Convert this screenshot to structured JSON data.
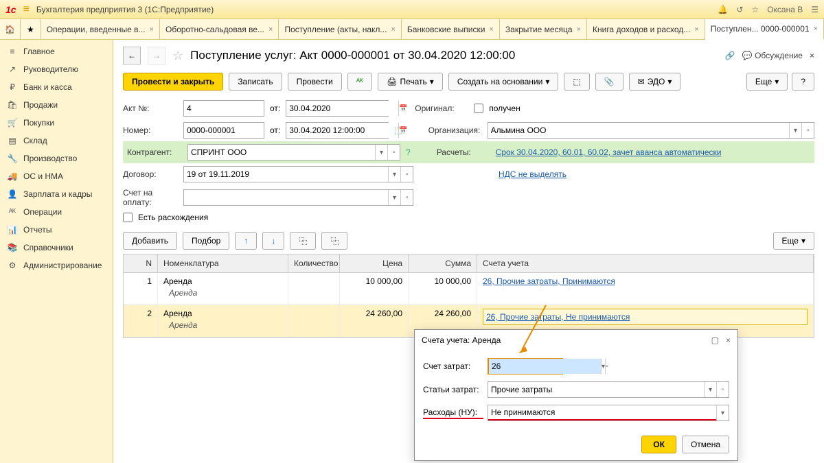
{
  "titlebar": {
    "app": "Бухгалтерия предприятия 3  (1С:Предприятие)",
    "user": "Оксана В"
  },
  "tabs": [
    {
      "label": "Операции, введенные в..."
    },
    {
      "label": "Оборотно-сальдовая ве..."
    },
    {
      "label": "Поступление (акты, накл..."
    },
    {
      "label": "Банковские выписки"
    },
    {
      "label": "Закрытие месяца"
    },
    {
      "label": "Книга доходов и расход..."
    },
    {
      "label": "Поступлен...  0000-000001",
      "active": true
    }
  ],
  "sidebar": [
    {
      "icon": "≡",
      "label": "Главное"
    },
    {
      "icon": "↗",
      "label": "Руководителю"
    },
    {
      "icon": "₽",
      "label": "Банк и касса"
    },
    {
      "icon": "🛍",
      "label": "Продажи"
    },
    {
      "icon": "🛒",
      "label": "Покупки"
    },
    {
      "icon": "▤",
      "label": "Склад"
    },
    {
      "icon": "🔧",
      "label": "Производство"
    },
    {
      "icon": "🚚",
      "label": "ОС и НМА"
    },
    {
      "icon": "👤",
      "label": "Зарплата и кадры"
    },
    {
      "icon": "ᴬᴷ",
      "label": "Операции"
    },
    {
      "icon": "📊",
      "label": "Отчеты"
    },
    {
      "icon": "📚",
      "label": "Справочники"
    },
    {
      "icon": "⚙",
      "label": "Администрирование"
    }
  ],
  "doc": {
    "title": "Поступление услуг: Акт 0000-000001 от 30.04.2020 12:00:00",
    "discuss": "Обсуждение",
    "buttons": {
      "post_close": "Провести и закрыть",
      "save": "Записать",
      "post": "Провести",
      "print": "Печать",
      "create_based": "Создать на основании",
      "edo": "ЭДО",
      "more": "Еще"
    },
    "fields": {
      "akt_label": "Акт №:",
      "akt": "4",
      "ot1": "от:",
      "date1": "30.04.2020",
      "nomer_label": "Номер:",
      "nomer": "0000-000001",
      "ot2": "от:",
      "date2": "30.04.2020 12:00:00",
      "kontragent_label": "Контрагент:",
      "kontragent": "СПРИНТ ООО",
      "dogovor_label": "Договор:",
      "dogovor": "19 от 19.11.2019",
      "schet_label": "Счет на оплату:",
      "original_label": "Оригинал:",
      "original_chk": "получен",
      "org_label": "Организация:",
      "org": "Альмина ООО",
      "raschety_label": "Расчеты:",
      "raschety_link": "Срок 30.04.2020, 60.01, 60.02, зачет аванса автоматически",
      "nds_link": "НДС не выделять",
      "rashozh": "Есть расхождения"
    },
    "tbl_btn": {
      "add": "Добавить",
      "select": "Подбор",
      "more": "Еще"
    },
    "columns": {
      "n": "N",
      "nom": "Номенклатура",
      "qty": "Количество",
      "price": "Цена",
      "sum": "Сумма",
      "acc": "Счета учета"
    },
    "rows": [
      {
        "n": "1",
        "nom": "Аренда",
        "nom2": "Аренда",
        "price": "10 000,00",
        "sum": "10 000,00",
        "acc": "26, Прочие затраты, Принимаются"
      },
      {
        "n": "2",
        "nom": "Аренда",
        "nom2": "Аренда",
        "price": "24 260,00",
        "sum": "24 260,00",
        "acc": "26, Прочие затраты, Не принимаются"
      }
    ]
  },
  "dialog": {
    "title": "Счета учета: Аренда",
    "schet_label": "Счет затрат:",
    "schet": "26",
    "statyi_label": "Статьи затрат:",
    "statyi": "Прочие затраты",
    "rash_label": "Расходы (НУ):",
    "rash": "Не принимаются",
    "ok": "ОК",
    "cancel": "Отмена"
  }
}
